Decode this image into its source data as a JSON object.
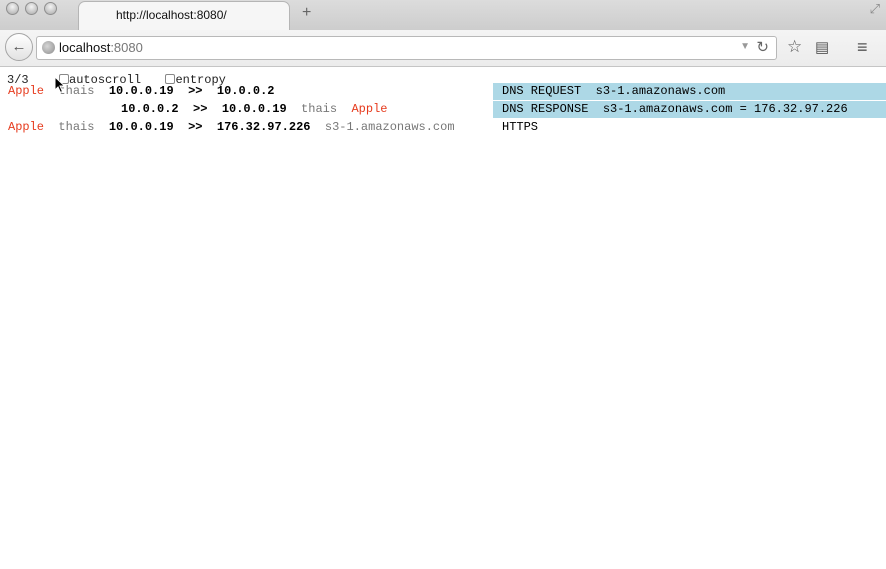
{
  "browser": {
    "tab_title": "http://localhost:8080/",
    "new_tab": "+",
    "url_host": "localhost",
    "url_port": ":8080"
  },
  "controls": {
    "count": "3/3",
    "autoscroll_label": "autoscroll",
    "entropy_label": "entropy"
  },
  "rows": [
    {
      "app": "Apple",
      "user": "thais",
      "src": "10.0.0.19",
      "arrow": ">>",
      "dst": "10.0.0.2",
      "user2": "",
      "app2": "",
      "host": "",
      "info": "DNS REQUEST  s3-1.amazonaws.com"
    },
    {
      "app": "",
      "user": "",
      "src": "10.0.0.2",
      "arrow": ">>",
      "dst": "10.0.0.19",
      "user2": "thais",
      "app2": "Apple",
      "host": "",
      "info": "DNS RESPONSE  s3-1.amazonaws.com = 176.32.97.226"
    },
    {
      "app": "Apple",
      "user": "thais",
      "src": "10.0.0.19",
      "arrow": ">>",
      "dst": "176.32.97.226",
      "user2": "",
      "app2": "",
      "host": "s3-1.amazonaws.com",
      "info": "HTTPS"
    }
  ],
  "colors": {
    "app": "#e63b1e",
    "dns_highlight": "#add8e6"
  }
}
